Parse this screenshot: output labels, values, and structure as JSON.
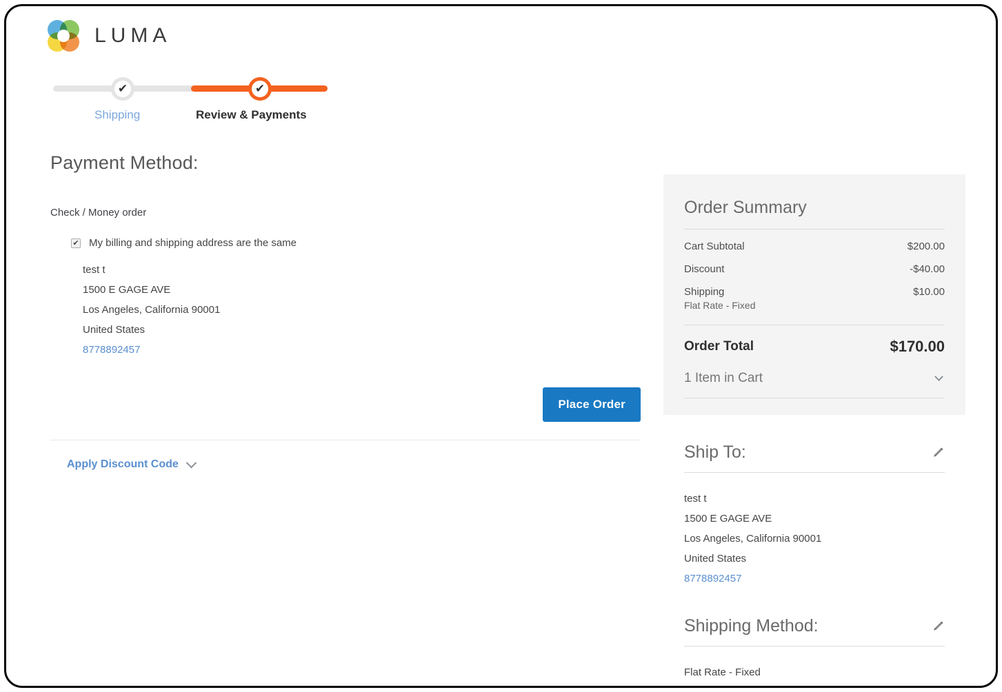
{
  "brand": {
    "name": "LUMA",
    "logo_icon": "luma-rings-logo"
  },
  "checkout_progress": {
    "steps": [
      {
        "label": "Shipping",
        "state": "complete",
        "check_glyph": "✔",
        "color": "#7ba7dd"
      },
      {
        "label": "Review & Payments",
        "state": "active",
        "check_glyph": "✔",
        "color": "#f4621f"
      }
    ]
  },
  "payment": {
    "title": "Payment Method:",
    "method_name": "Check / Money order",
    "billing_same_checkbox": {
      "label": "My billing and shipping address are the same",
      "checked": true,
      "check_glyph": "✔"
    },
    "billing_address": {
      "name": "test t",
      "street": "1500 E GAGE AVE",
      "city_state_zip": "Los Angeles, California 90001",
      "country": "United States",
      "phone": "8778892457"
    },
    "place_order_label": "Place Order",
    "place_order_color": "#1979c3",
    "discount_label": "Apply Discount Code",
    "discount_icon": "chevron-down-icon"
  },
  "order_summary": {
    "title": "Order Summary",
    "rows": [
      {
        "label": "Cart Subtotal",
        "sublabel": "",
        "value": "$200.00"
      },
      {
        "label": "Discount",
        "sublabel": "",
        "value": "-$40.00"
      },
      {
        "label": "Shipping",
        "sublabel": "Flat Rate - Fixed",
        "value": "$10.00"
      }
    ],
    "total_label": "Order Total",
    "total_value": "$170.00",
    "cart_items_label": "1 Item in Cart",
    "cart_items_icon": "chevron-down-icon"
  },
  "ship_to": {
    "title": "Ship To:",
    "edit_icon": "pencil-icon",
    "name": "test t",
    "street": "1500 E GAGE AVE",
    "city_state_zip": "Los Angeles, California 90001",
    "country": "United States",
    "phone": "8778892457"
  },
  "shipping_method": {
    "title": "Shipping Method:",
    "edit_icon": "pencil-icon",
    "value": "Flat Rate - Fixed"
  }
}
